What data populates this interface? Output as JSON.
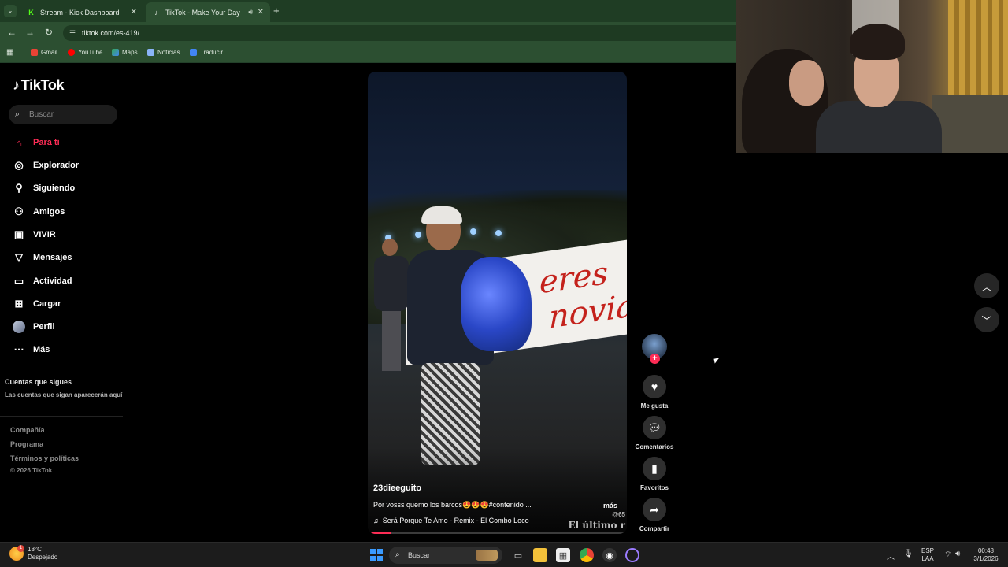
{
  "browser": {
    "tabs": [
      {
        "title": "Stream - Kick Dashboard",
        "icon": "kick-icon"
      },
      {
        "title": "TikTok - Make Your Day",
        "icon": "tiktok-icon",
        "active": true
      }
    ],
    "url": "tiktok.com/es-419/",
    "bookmarks": [
      "Gmail",
      "YouTube",
      "Maps",
      "Noticias",
      "Traducir"
    ]
  },
  "sidebar": {
    "logo": "TikTok",
    "search_placeholder": "Buscar",
    "nav": [
      {
        "label": "Para ti",
        "icon": "home-icon",
        "active": true
      },
      {
        "label": "Explorador",
        "icon": "compass-icon"
      },
      {
        "label": "Siguiendo",
        "icon": "following-icon"
      },
      {
        "label": "Amigos",
        "icon": "friends-icon"
      },
      {
        "label": "VIVIR",
        "icon": "live-icon"
      },
      {
        "label": "Mensajes",
        "icon": "messages-icon"
      },
      {
        "label": "Actividad",
        "icon": "activity-icon"
      },
      {
        "label": "Cargar",
        "icon": "upload-icon"
      },
      {
        "label": "Perfil",
        "icon": "profile-avatar"
      },
      {
        "label": "Más",
        "icon": "more-icon"
      }
    ],
    "following_title": "Cuentas que sigues",
    "following_sub": "Las cuentas que sigan aparecerán aquí",
    "footer": [
      "Compañía",
      "Programa",
      "Términos y políticas"
    ],
    "copyright": "© 2026 TikTok"
  },
  "video": {
    "username": "23dieeguito",
    "description": "Por vosss quemo los barcos😍😍😍#contenido ...",
    "more": "más",
    "music": "Será Porque Te Amo - Remix - El Combo Loco",
    "watermark": "El último r",
    "watermark_handle": "@65",
    "banner_line1": "eres",
    "banner_line2": "novia",
    "progress": 0.09
  },
  "actions": [
    {
      "label": "Me gusta",
      "icon": "heart-icon"
    },
    {
      "label": "Comentarios",
      "icon": "comment-icon"
    },
    {
      "label": "Favoritos",
      "icon": "bookmark-icon"
    },
    {
      "label": "Compartir",
      "icon": "share-icon"
    }
  ],
  "taskbar": {
    "temperature": "18°C",
    "weather": "Despejado",
    "weather_badge": "1",
    "search": "Buscar",
    "lang1": "ESP",
    "lang2": "LAA",
    "time": "00:48",
    "date": "3/1/2026"
  },
  "colors": {
    "accent": "#fe2c55",
    "chrome": "#2c4f31"
  }
}
